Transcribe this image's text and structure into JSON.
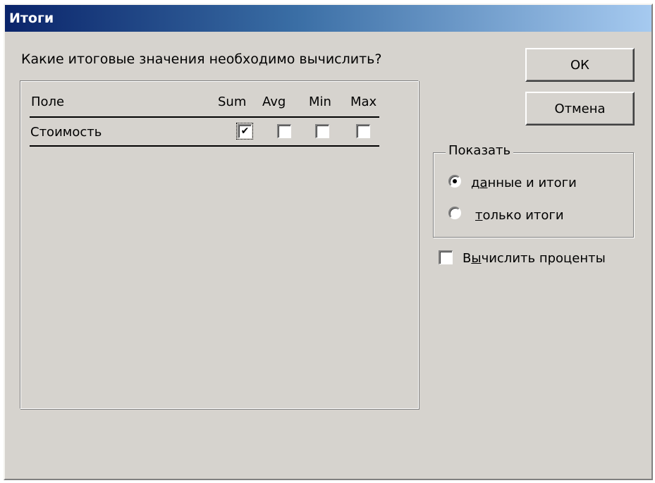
{
  "window": {
    "title": "Итоги"
  },
  "prompt": "Какие итоговые значения необходимо вычислить?",
  "table": {
    "columns": [
      "Поле",
      "Sum",
      "Avg",
      "Min",
      "Max"
    ],
    "rows": [
      {
        "field": "Стоимость",
        "sum": true,
        "avg": false,
        "min": false,
        "max": false
      }
    ]
  },
  "buttons": {
    "ok": "ОК",
    "cancel": "Отмена"
  },
  "show_group": {
    "legend": "Показать",
    "options": [
      {
        "label_before": "д",
        "label_underlined": "а",
        "label_after": "нные и итоги",
        "selected": true
      },
      {
        "label_before": "",
        "label_underlined": "т",
        "label_after": "олько итоги",
        "selected": false
      }
    ]
  },
  "percent_checkbox": {
    "label_before": "В",
    "label_underlined": "ы",
    "label_after": "числить проценты",
    "checked": false
  },
  "icons": {
    "check": "✔"
  }
}
